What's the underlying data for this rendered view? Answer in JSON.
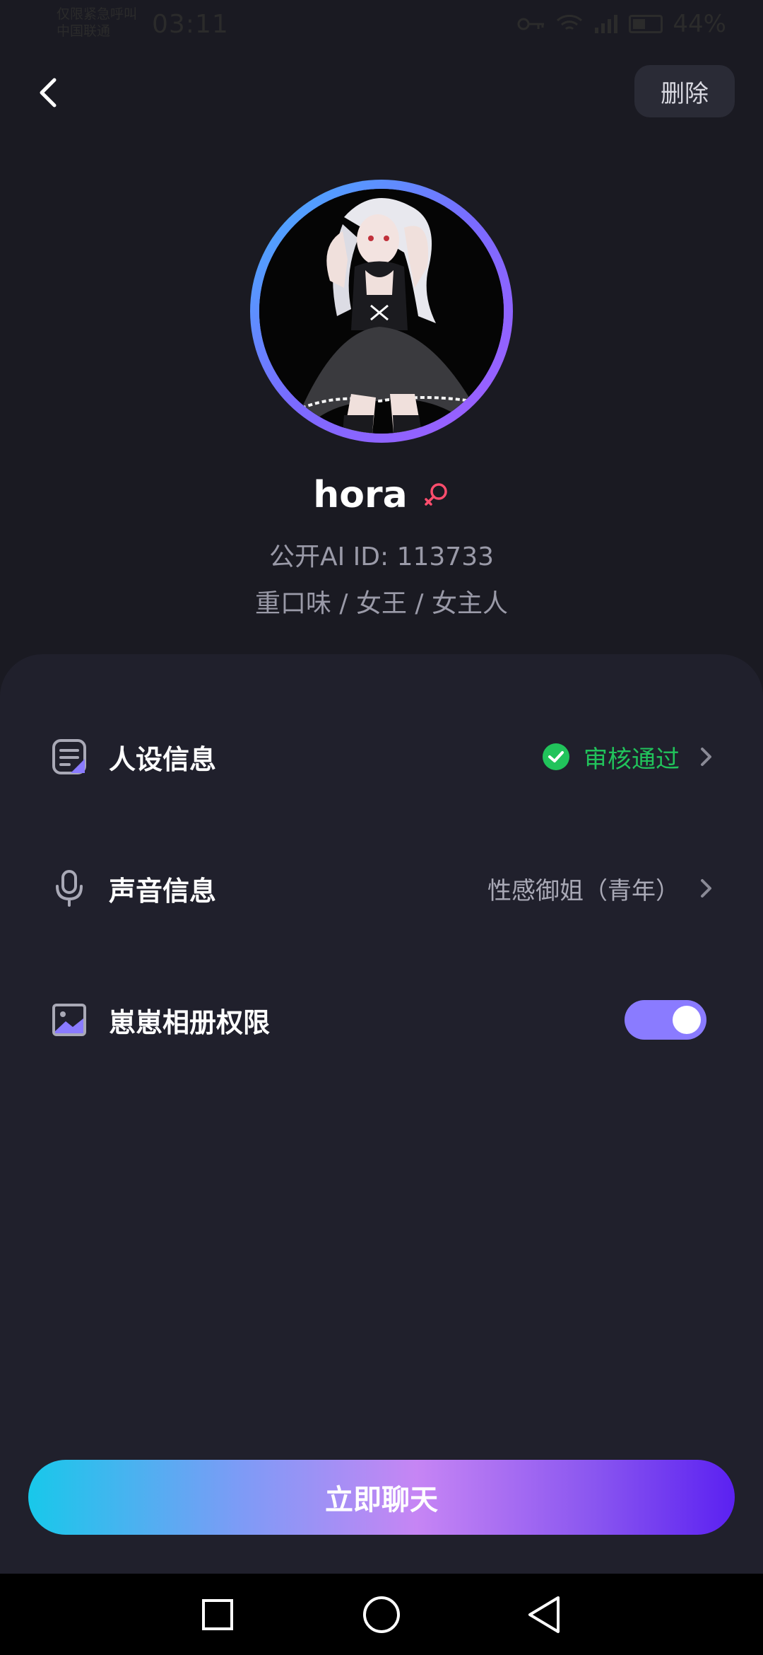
{
  "status_bar": {
    "carrier_line1": "仅限紧急呼叫",
    "carrier_line2": "中国联通",
    "time": "03:11",
    "battery": "44%",
    "icons": [
      "key-icon",
      "wifi-icon",
      "signal-icon",
      "battery-icon"
    ]
  },
  "header": {
    "back_icon": "chevron-left-icon",
    "delete_label": "删除"
  },
  "profile": {
    "name": "hora",
    "gender_icon": "female-icon",
    "id_line": "公开AI  ID:  113733",
    "tags_line": "重口味 / 女王 / 女主人"
  },
  "settings": {
    "persona": {
      "label": "人设信息",
      "status": "审核通过"
    },
    "voice": {
      "label": "声音信息",
      "value": "性感御姐（青年）"
    },
    "album": {
      "label": "崽崽相册权限",
      "enabled": true
    }
  },
  "cta_label": "立即聊天",
  "colors": {
    "accent": "#8a7bff",
    "success": "#21c35b",
    "background": "#1a1a22",
    "panel": "#20202c"
  }
}
